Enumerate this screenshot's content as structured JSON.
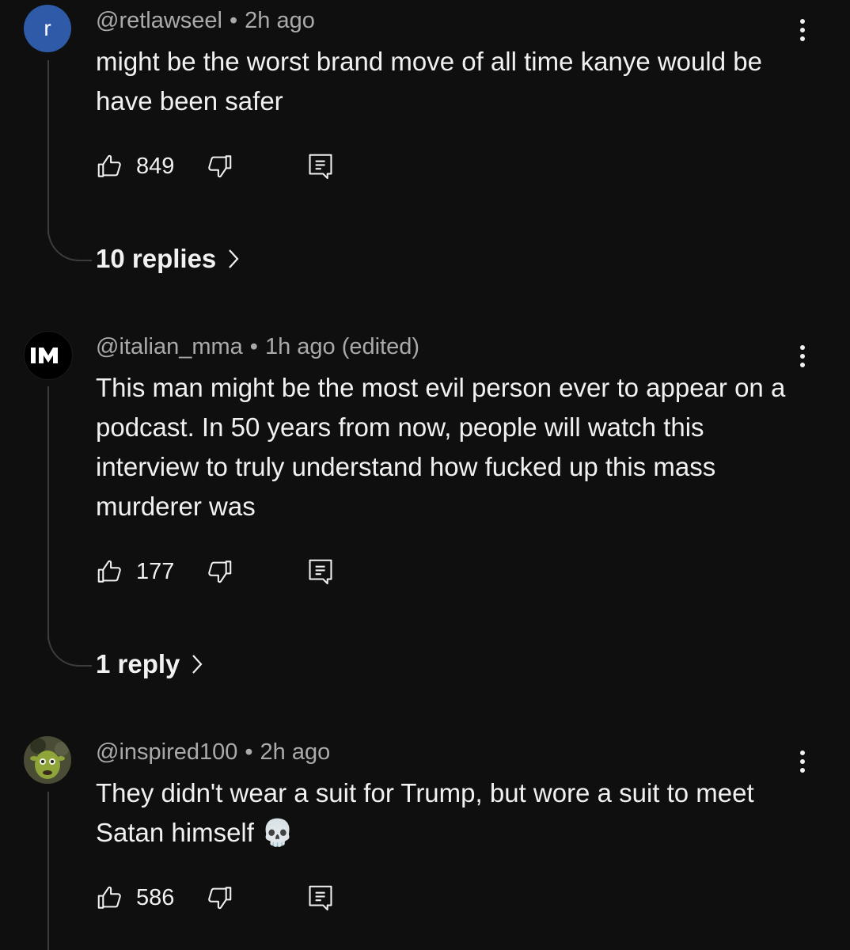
{
  "comments": [
    {
      "avatar_letter": "r",
      "avatar_color": "#2f5aa8",
      "handle": "@retlawseel",
      "time": "2h ago",
      "text": "might be the worst brand move of all time kanye would be have been safer",
      "likes": "849",
      "replies_label": "10 replies"
    },
    {
      "avatar_logo": "IM",
      "handle": "@italian_mma",
      "time": "1h ago (edited)",
      "text": "This man might be the most evil person ever to appear on a podcast. In 50 years from now, people will watch this interview to truly understand how fucked up this mass murderer was",
      "likes": "177",
      "replies_label": "1 reply"
    },
    {
      "avatar_icon": "shrek-avatar",
      "handle": "@inspired100",
      "time": "2h ago",
      "text": "They didn't wear a suit for Trump, but wore a suit to meet Satan himself 💀",
      "likes": "586"
    }
  ],
  "separator": "•",
  "icons": {
    "like": "thumbs-up-icon",
    "dislike": "thumbs-down-icon",
    "reply": "reply-comment-icon",
    "more": "more-vertical-icon",
    "chevron": "chevron-right-icon"
  },
  "colors": {
    "background": "#0f0f0f",
    "text": "#f1f1f1",
    "meta": "#aaaaaa",
    "thread_line": "#3c3c3c"
  }
}
